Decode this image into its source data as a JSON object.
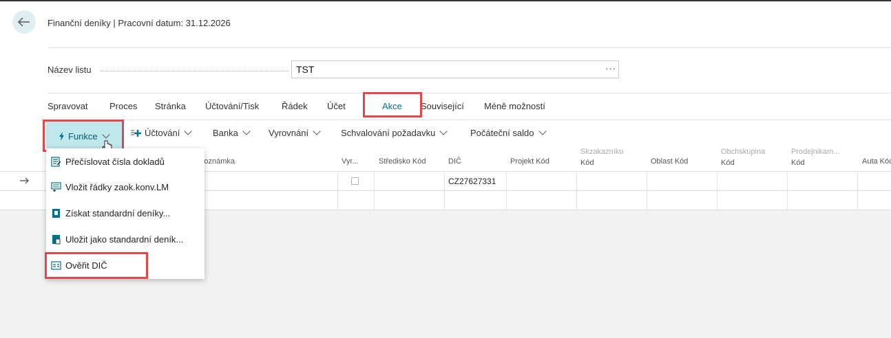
{
  "header": {
    "title": "Finanční deníky | Pracovní datum: 31.12.2026"
  },
  "batch": {
    "label": "Název listu",
    "value": "TST",
    "more": "···"
  },
  "tabs": [
    {
      "label": "Spravovat"
    },
    {
      "label": "Proces"
    },
    {
      "label": "Stránka"
    },
    {
      "label": "Účtování/Tisk"
    },
    {
      "label": "Řádek"
    },
    {
      "label": "Účet"
    },
    {
      "label": "Akce"
    },
    {
      "label": "Související"
    },
    {
      "label": "Méně možností"
    }
  ],
  "actions": {
    "funkce": "Funkce",
    "uctovani": "Účtování",
    "banka": "Banka",
    "vyrovnani": "Vyrovnání",
    "schvalovani": "Schvalování požadavku",
    "pocatecni": "Počáteční saldo"
  },
  "menu": {
    "items": [
      {
        "label": "Přečíslovat čísla dokladů",
        "icon": "renumber-icon"
      },
      {
        "label": "Vložit řádky zaok.konv.LM",
        "icon": "insert-lines-icon"
      },
      {
        "label": "Získat standardní deníky...",
        "icon": "get-journal-icon"
      },
      {
        "label": "Uložit jako standardní deník...",
        "icon": "save-journal-icon"
      },
      {
        "label": "Ověřit DIČ",
        "icon": "verify-vat-icon"
      }
    ]
  },
  "grid": {
    "columns": {
      "poznamka": "Poznámka",
      "vyr": "Vyr...",
      "stredisko": "Středisko Kód",
      "dic": "DIČ",
      "projekt": "Projekt Kód",
      "skzakazniku1": "Skzakazníku",
      "skzakazniku2": "Kód",
      "oblast": "Oblast Kód",
      "obchskupina1": "Obchskupina",
      "obchskupina2": "Kód",
      "prodejnikam1": "Prodejnikam...",
      "prodejnikam2": "Kód",
      "auta": "Auta Kód"
    },
    "rows": [
      {
        "dic": "CZ27627331"
      }
    ]
  },
  "colors": {
    "accent": "#00718b",
    "highlight": "#e2474b",
    "button_bg": "#bfe7ec"
  }
}
